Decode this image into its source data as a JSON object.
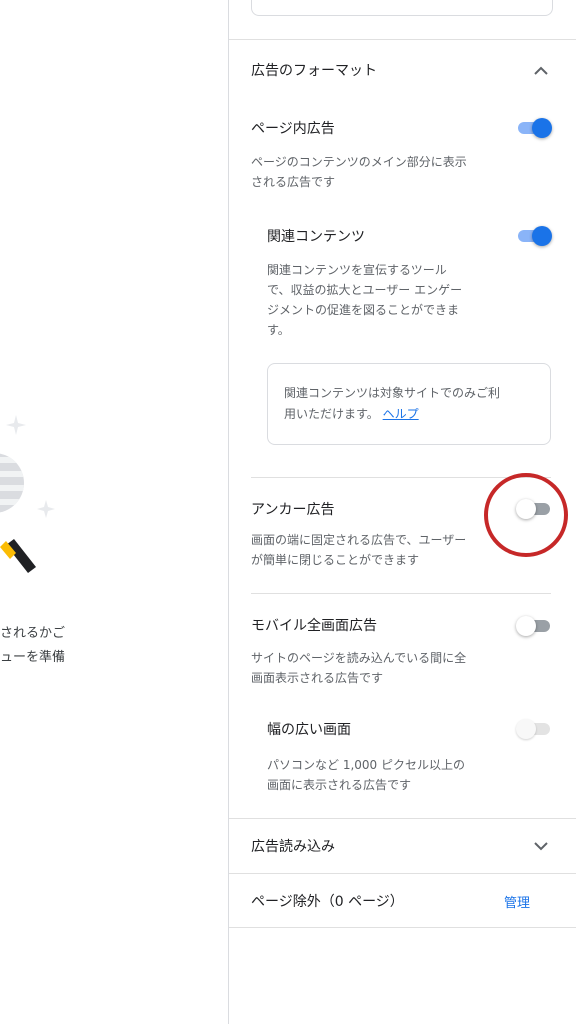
{
  "preview": {
    "text": "されるかご\nューを準備"
  },
  "format_section": {
    "title": "広告のフォーマット"
  },
  "in_page_ads": {
    "title": "ページ内広告",
    "desc": "ページのコンテンツのメイン部分に表示\nされる広告です",
    "toggle": "on"
  },
  "related_content": {
    "title": "関連コンテンツ",
    "desc": "関連コンテンツを宣伝するツール\nで、収益の拡大とユーザー エンゲー\nジメントの促進を図ることができま\nす。",
    "toggle": "on",
    "note": "関連コンテンツは対象サイトでのみご利\n用いただけます。",
    "help_link": "ヘルプ"
  },
  "anchor_ads": {
    "title": "アンカー広告",
    "desc": "画面の端に固定される広告で、ユーザー\nが簡単に閉じることができます",
    "toggle": "off"
  },
  "mobile_fullscreen": {
    "title": "モバイル全画面広告",
    "desc": "サイトのページを読み込んでいる間に全\n画面表示される広告です",
    "toggle": "off"
  },
  "wide_screen": {
    "title": "幅の広い画面",
    "desc": "パソコンなど 1,000 ピクセル以上の\n画面に表示される広告です",
    "toggle": "disabled"
  },
  "ad_loading": {
    "title": "広告読み込み"
  },
  "page_exclusions": {
    "title": "ページ除外（0 ページ）",
    "manage_label": "管理"
  },
  "colors": {
    "accent": "#1a73e8",
    "highlight": "#c62828"
  }
}
